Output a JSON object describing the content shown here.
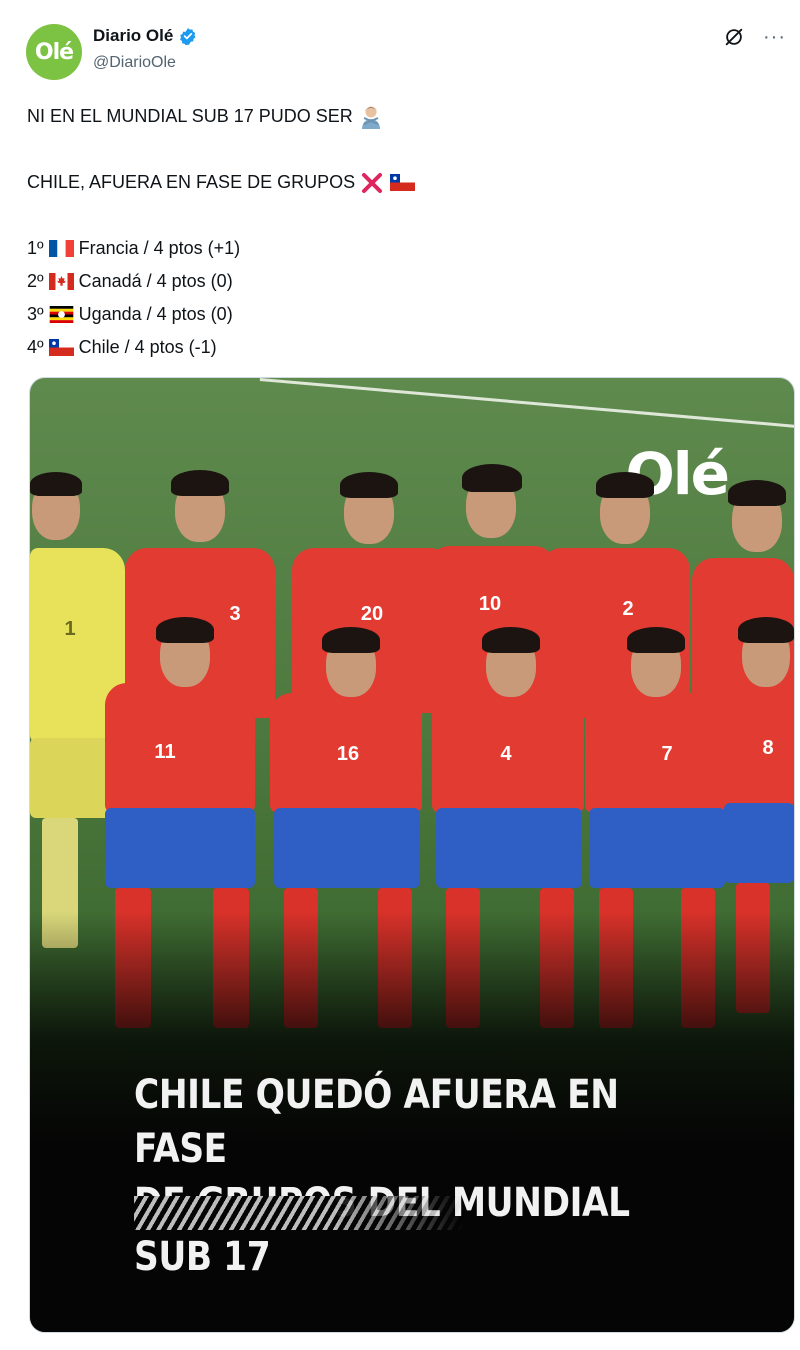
{
  "author": {
    "display_name": "Diario Olé",
    "handle": "@DiarioOle",
    "avatar_text": "Olé",
    "verified": true
  },
  "icons": {
    "verified": "verified-badge-icon",
    "grok": "grok-icon",
    "more": "more-options-icon"
  },
  "post": {
    "line1": "NI EN EL MUNDIAL SUB 17 PUDO SER",
    "line2": "CHILE, AFUERA EN FASE DE GRUPOS",
    "standings": [
      {
        "pos": "1º",
        "team": "Francia / 4 ptos (+1)",
        "flag": "france"
      },
      {
        "pos": "2º",
        "team": "Canadá / 4 ptos (0)",
        "flag": "canada"
      },
      {
        "pos": "3º",
        "team": "Uganda / 4 ptos (0)",
        "flag": "uganda"
      },
      {
        "pos": "4º",
        "team": "Chile / 4 ptos (-1)",
        "flag": "chile"
      }
    ]
  },
  "media": {
    "logo": "Olé",
    "headline_1": "CHILE QUEDÓ AFUERA EN FASE",
    "headline_2": "DE GRUPOS DEL MUNDIAL SUB 17",
    "shirt_numbers": [
      "1",
      "3",
      "20",
      "10",
      "2",
      "11",
      "16",
      "4",
      "7",
      "8"
    ]
  },
  "colors": {
    "text": "#0f1419",
    "secondary": "#536471",
    "verified": "#1d9bf0",
    "brand_green": "#7cc243",
    "chile_red": "#e23b31",
    "shorts_blue": "#2f5fc4"
  }
}
